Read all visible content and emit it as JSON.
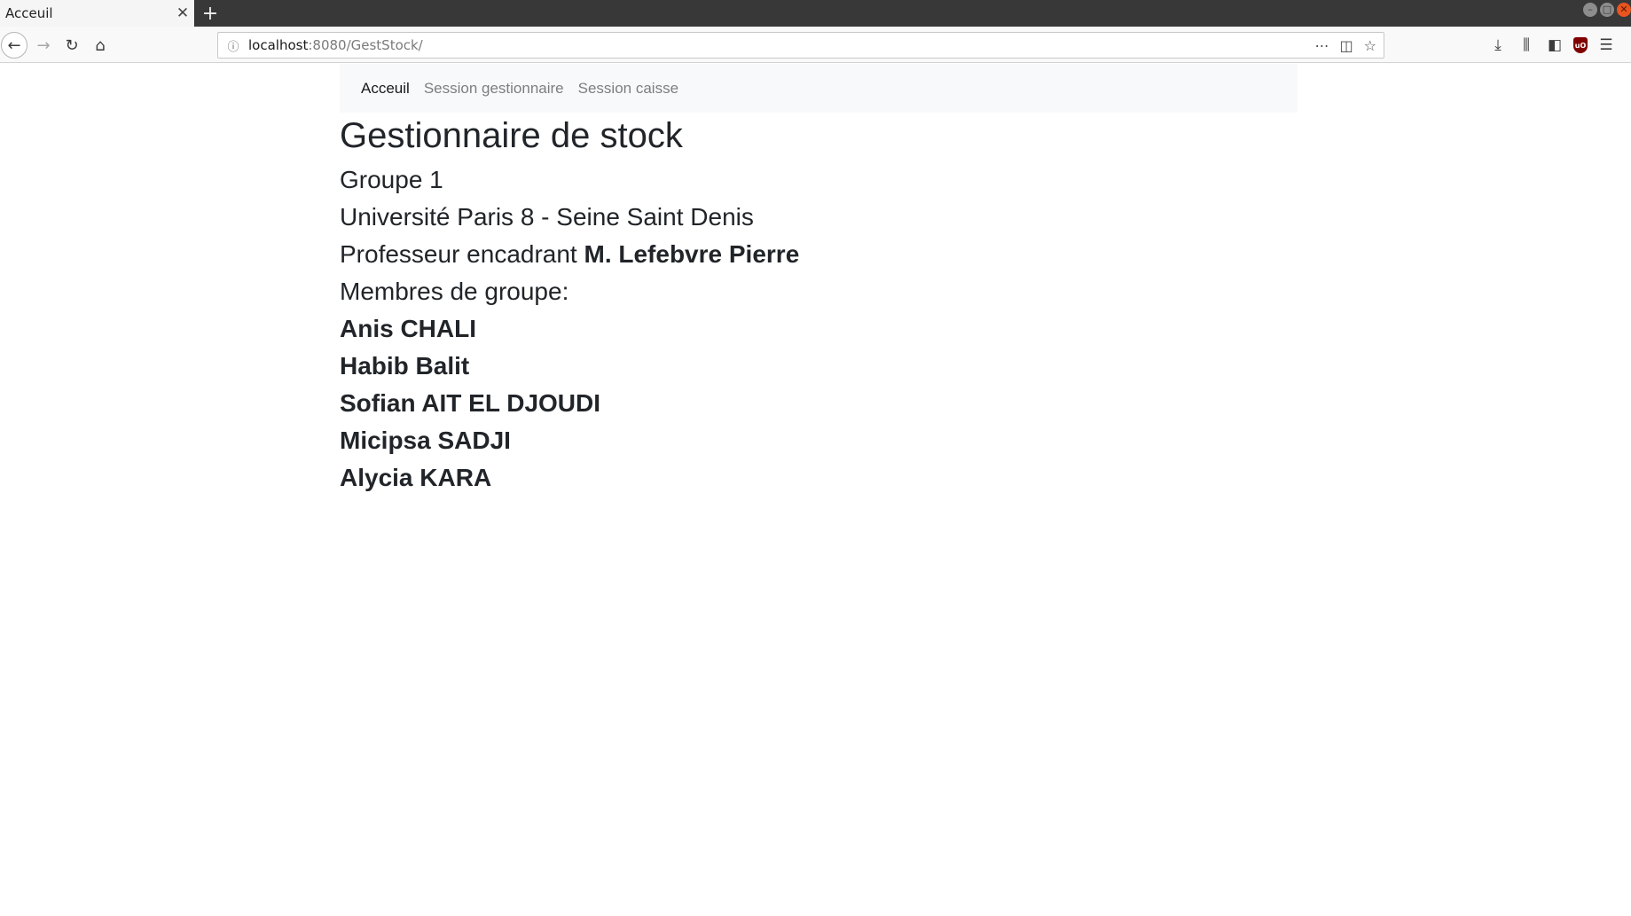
{
  "browser": {
    "tab_title": "Acceuil",
    "tab_close": "✕",
    "new_tab": "+",
    "url_host": "localhost",
    "url_rest": ":8080/GestStock/"
  },
  "nav": {
    "items": [
      {
        "label": "Acceuil",
        "active": true
      },
      {
        "label": "Session gestionnaire",
        "active": false
      },
      {
        "label": "Session caisse",
        "active": false
      }
    ]
  },
  "main": {
    "title": "Gestionnaire de stock",
    "group": "Groupe 1",
    "university": "Université Paris 8 - Seine Saint Denis",
    "professor_prefix": "Professeur encadrant",
    "professor_name": "M. Lefebvre Pierre",
    "members_label": "Membres de groupe:",
    "members": [
      "Anis CHALI",
      "Habib Balit",
      "Sofian AIT EL DJOUDI",
      "Micipsa SADJI",
      "Alycia KARA"
    ]
  }
}
